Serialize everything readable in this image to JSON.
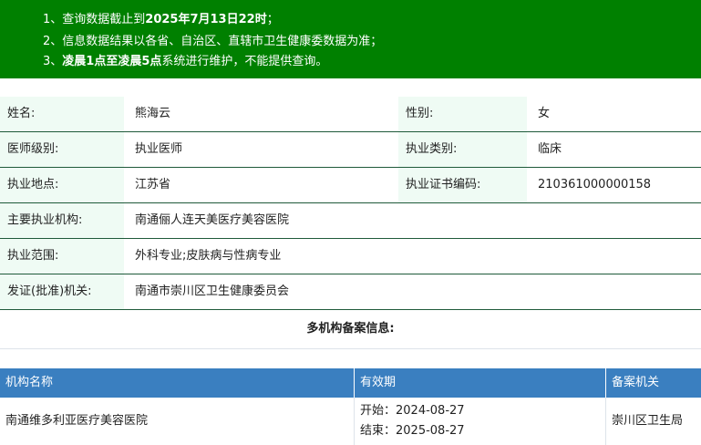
{
  "notice": {
    "line1_prefix": "1、查询数据截止到",
    "line1_bold": "2025年7月13日22时",
    "line1_suffix": "；",
    "line2": "2、信息数据结果以各省、自治区、直辖市卫生健康委数据为准；",
    "line3_prefix": "3、",
    "line3_bold": "凌晨1点至凌晨5点",
    "line3_suffix": "系统进行维护，不能提供查询。"
  },
  "doctor": {
    "name_label": "姓名:",
    "name": "熊海云",
    "gender_label": "性别:",
    "gender": "女",
    "level_label": "医师级别:",
    "level": "执业医师",
    "category_label": "执业类别:",
    "category": "临床",
    "location_label": "执业地点:",
    "location": "江苏省",
    "cert_label": "执业证书编码:",
    "cert_no": "210361000000158",
    "org_label": "主要执业机构:",
    "org": "南通俪人连天美医疗美容医院",
    "scope_label": "执业范围:",
    "scope": "外科专业;皮肤病与性病专业",
    "authority_label": "发证(批准)机关:",
    "authority": "南通市崇川区卫生健康委员会"
  },
  "multi": {
    "title": "多机构备案信息:",
    "headers": [
      "机构名称",
      "有效期",
      "备案机关"
    ],
    "rows": [
      {
        "org": "南通维多利亚医疗美容医院",
        "start": "开始：2024-08-27",
        "end": "结束：2025-08-27",
        "authority": "崇川区卫生局"
      }
    ]
  },
  "colors": {
    "notice_bg": "#008000",
    "label_bg": "#effbf4",
    "table_header_bg": "#3a7fc0"
  }
}
